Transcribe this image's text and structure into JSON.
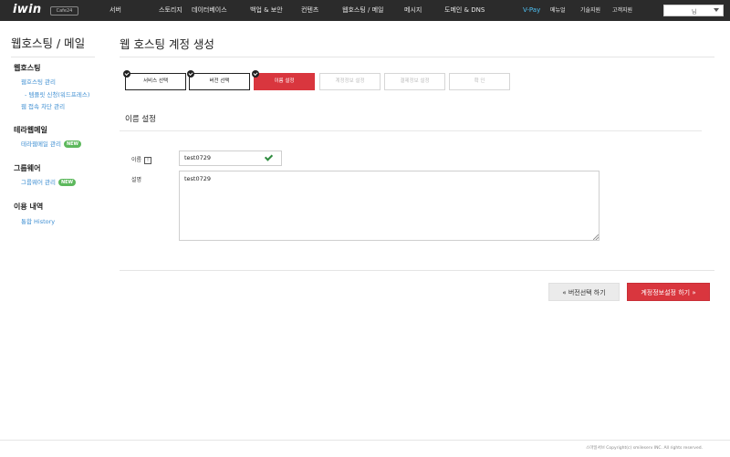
{
  "topnav": {
    "logo": "iwin",
    "logo_badge": "Cafe24",
    "items": [
      "서버",
      "스토리지",
      "데이터베이스",
      "백업 & 보안",
      "컨텐츠",
      "웹호스팅 / 메일",
      "메시지",
      "도메인 & DNS"
    ],
    "vpay": "V-Pay",
    "util": [
      "메뉴얼",
      "기술지원",
      "고객지원"
    ],
    "select_value": "님"
  },
  "sidebar": {
    "title": "웹호스팅 / 메일",
    "sections": [
      {
        "heading": "웹호스팅",
        "links": [
          "웹호스팅 관리",
          "- 템플릿 신청(워드프레스)",
          "웹 접속 차단 관리"
        ]
      },
      {
        "heading": "테라웹메일",
        "links": [
          "테라웹메일 관리"
        ],
        "badge": "NEW"
      },
      {
        "heading": "그룹웨어",
        "links": [
          "그룹웨어 관리"
        ],
        "badge": "NEW"
      },
      {
        "heading": "이용 내역",
        "links": [
          "통합 History"
        ]
      }
    ]
  },
  "main": {
    "title": "웹 호스팅 계정 생성",
    "steps": [
      {
        "label": "서비스 선택",
        "state": "done"
      },
      {
        "label": "버전 선택",
        "state": "done"
      },
      {
        "label": "이름 설정",
        "state": "active"
      },
      {
        "label": "계정정보 설정",
        "state": "pending"
      },
      {
        "label": "결제정보 설정",
        "state": "pending"
      },
      {
        "label": "확 인",
        "state": "pending"
      }
    ],
    "section_title": "이름 설정",
    "name_label": "이름",
    "name_required_mark": "!",
    "name_value": "test0729",
    "desc_label": "설명",
    "desc_value": "test0729",
    "btn_prev": "« 버전선택 하기",
    "btn_next": "계정정보설정 하기 »"
  },
  "footer": "스마일서브 Copyright(c) smileserv INC. All rights reserved.",
  "colors": {
    "accent": "#d9363e",
    "topbar": "#2b2b2b",
    "link": "#3f8fd2",
    "badge": "#5cb85c",
    "check": "#2e8b3e"
  }
}
